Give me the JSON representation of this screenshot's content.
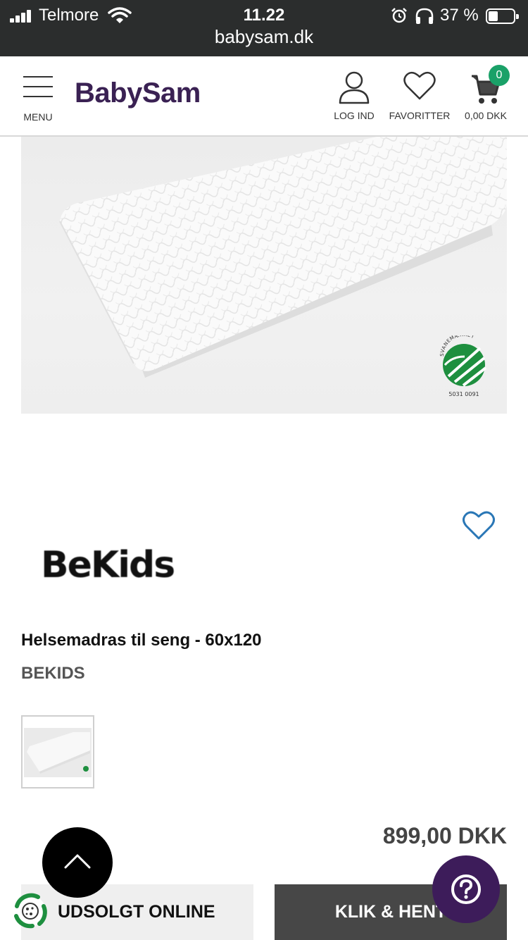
{
  "status_bar": {
    "carrier": "Telmore",
    "time": "11.22",
    "battery_percent": "37 %",
    "url": "babysam.dk"
  },
  "header": {
    "menu_label": "MENU",
    "logo_text": "BabySam",
    "login_label": "LOG IND",
    "favorites_label": "FAVORITTER",
    "cart_total": "0,00 DKK",
    "cart_count": "0",
    "logo_color": "#3a2153",
    "badge_color": "#1aa168"
  },
  "product": {
    "image_badge_text": "SVANEMÆRKET",
    "image_badge_number": "5031 0091",
    "brand_logo_text": "BeKids",
    "title": "Helsemadras til seng - 60x120",
    "brand": "BEKIDS",
    "price": "899,00 DKK"
  },
  "actions": {
    "sold_out_label": "UDSOLGT ONLINE",
    "click_collect_label": "KLIK & HENT",
    "help_icon": "question-icon",
    "scroll_top_icon": "chevron-up-icon",
    "help_color": "#3d1c5a"
  }
}
